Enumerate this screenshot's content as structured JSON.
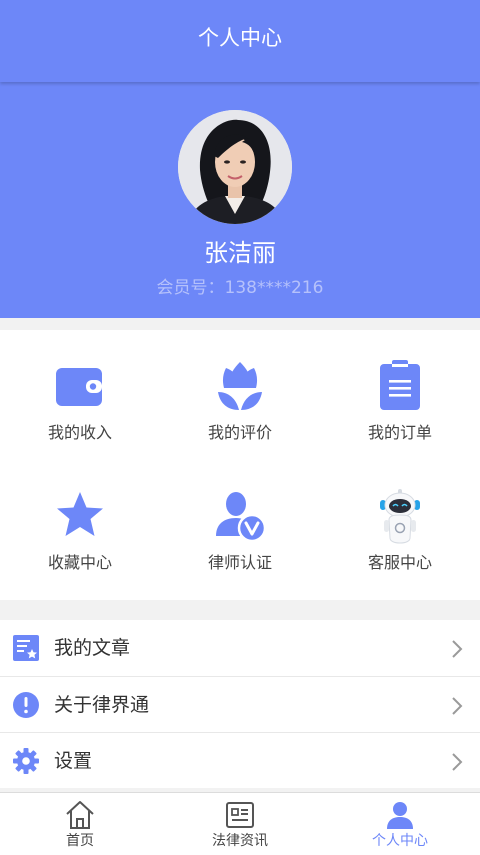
{
  "header": {
    "title": "个人中心"
  },
  "profile": {
    "name": "张洁丽",
    "member_no": "会员号：138****216"
  },
  "grid": [
    {
      "label": "我的收入",
      "icon": "wallet-icon"
    },
    {
      "label": "我的评价",
      "icon": "tulip-icon"
    },
    {
      "label": "我的订单",
      "icon": "clipboard-icon"
    },
    {
      "label": "收藏中心",
      "icon": "star-icon"
    },
    {
      "label": "律师认证",
      "icon": "lawyer-verify-icon"
    },
    {
      "label": "客服中心",
      "icon": "robot-icon"
    }
  ],
  "menu": [
    {
      "label": "我的文章",
      "icon": "article-icon"
    },
    {
      "label": "关于律界通",
      "icon": "info-icon"
    },
    {
      "label": "设置",
      "icon": "gear-icon"
    }
  ],
  "tabs": [
    {
      "label": "首页",
      "icon": "home-icon",
      "active": false
    },
    {
      "label": "法律资讯",
      "icon": "news-icon",
      "active": false
    },
    {
      "label": "个人中心",
      "icon": "user-icon",
      "active": true
    }
  ],
  "colors": {
    "accent": "#6d87f8",
    "icon": "#6d87f8",
    "text": "#333333"
  }
}
